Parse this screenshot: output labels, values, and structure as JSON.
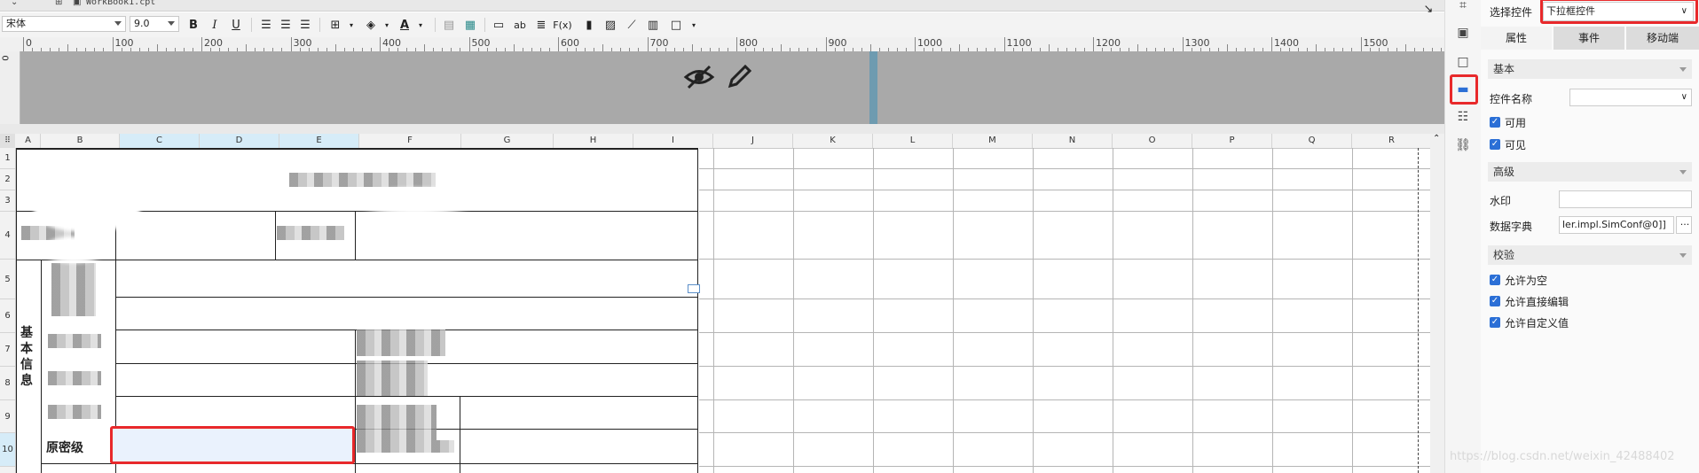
{
  "tabbar": {
    "file_tab": "WorkBook1.cpt"
  },
  "toolbar": {
    "font_name": "宋体",
    "font_size": "9.0",
    "bold": "B",
    "italic": "I",
    "underline": "U",
    "format_text": "ab",
    "formula_label": "F(x)"
  },
  "ruler": {
    "marks": [
      "0",
      "100",
      "200",
      "300",
      "400",
      "500",
      "600",
      "700",
      "800",
      "900",
      "1000",
      "1100",
      "1200",
      "1300",
      "1400",
      "1500"
    ]
  },
  "vruler_mark": "0",
  "columns": [
    "A",
    "B",
    "C",
    "D",
    "E",
    "F",
    "G",
    "H",
    "I",
    "J",
    "K",
    "L",
    "M",
    "N",
    "O",
    "P",
    "Q",
    "R"
  ],
  "rows": [
    "1",
    "2",
    "3",
    "4",
    "5",
    "6",
    "7",
    "8",
    "9",
    "10"
  ],
  "sheet": {
    "section_label": "基本信息",
    "original_secret_label": "原密级"
  },
  "panel": {
    "select_control_label": "选择控件",
    "select_control_value": "下拉框控件",
    "tabs": [
      "属性",
      "事件",
      "移动端"
    ],
    "sections": {
      "basic": "基本",
      "advanced": "高级",
      "validation": "校验"
    },
    "control_name_label": "控件名称",
    "control_name_value": "",
    "enabled_label": "可用",
    "visible_label": "可见",
    "watermark_label": "水印",
    "watermark_value": "",
    "dict_label": "数据字典",
    "dict_value": "ler.impl.SimConf@0]]",
    "dict_more": "···",
    "allow_empty_label": "允许为空",
    "allow_edit_label": "允许直接编辑",
    "allow_custom_label": "允许自定义值"
  },
  "watermark_text": "https://blog.csdn.net/weixin_42488402",
  "colors": {
    "accent": "#2b6fd6",
    "highlight_red": "#e8292b",
    "selected_cell": "#eaf2fd"
  }
}
